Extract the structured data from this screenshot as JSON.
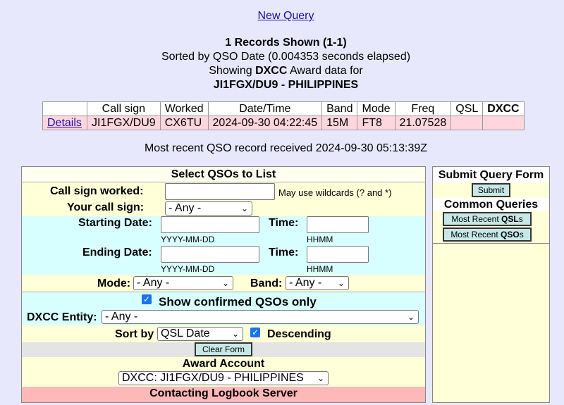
{
  "header": {
    "new_query": "New Query"
  },
  "summary": {
    "records_shown": "1 Records Shown (1-1)",
    "sorted_by": "Sorted by QSO Date (0.004353 seconds elapsed)",
    "showing_prefix": "Showing ",
    "showing_award": "DXCC",
    "showing_suffix": " Award data for",
    "entity": "JI1FGX/DU9 - PHILIPPINES"
  },
  "results": {
    "columns": [
      "",
      "Call sign",
      "Worked",
      "Date/Time",
      "Band",
      "Mode",
      "Freq",
      "QSL",
      "DXCC"
    ],
    "rows": [
      {
        "details": "Details",
        "call_sign": "JI1FGX/DU9",
        "worked": "CX6TU",
        "datetime": "2024-09-30 04:22:45",
        "band": "15M",
        "mode": "FT8",
        "freq": "21.07528",
        "qsl": "",
        "dxcc": ""
      }
    ]
  },
  "most_recent": "Most recent QSO record received 2024-09-30 05:13:39Z",
  "form": {
    "title": "Select QSOs to List",
    "call_worked_label": "Call sign worked:",
    "call_worked_value": "",
    "wildcard_note": "May use wildcards (? and *)",
    "your_call_label": "Your call sign:",
    "your_call_value": "- Any -",
    "start_date_label": "Starting Date:",
    "start_time_label": "Time:",
    "date_hint": "YYYY-MM-DD",
    "time_hint": "HHMM",
    "end_date_label": "Ending Date:",
    "end_time_label": "Time:",
    "mode_label": "Mode:",
    "mode_value": "- Any -",
    "band_label": "Band:",
    "band_value": "- Any -",
    "confirmed_label": "Show confirmed QSOs only",
    "dxcc_label": "DXCC Entity:",
    "dxcc_value": "- Any -",
    "sort_label": "Sort by",
    "sort_value": "QSL Date",
    "descending_label": "Descending",
    "clear_button": "Clear Form",
    "award_account_label": "Award Account",
    "award_account_value": "DXCC: JI1FGX/DU9 - PHILIPPINES",
    "status": "Contacting Logbook Server"
  },
  "side": {
    "submit_title": "Submit Query Form",
    "submit_button": "Submit",
    "common_title": "Common Queries",
    "qsl_button_prefix": "Most Recent ",
    "qsl_button_bold": "QSL",
    "qsl_button_suffix": "s",
    "qso_button_prefix": "Most Recent ",
    "qso_button_bold": "QSO",
    "qso_button_suffix": "s"
  },
  "colors": {
    "link": "#1a0dab",
    "page_bg": "#e8e8fc",
    "checkbox": "#1a73e8",
    "status_bg": "#ffb8b8"
  }
}
